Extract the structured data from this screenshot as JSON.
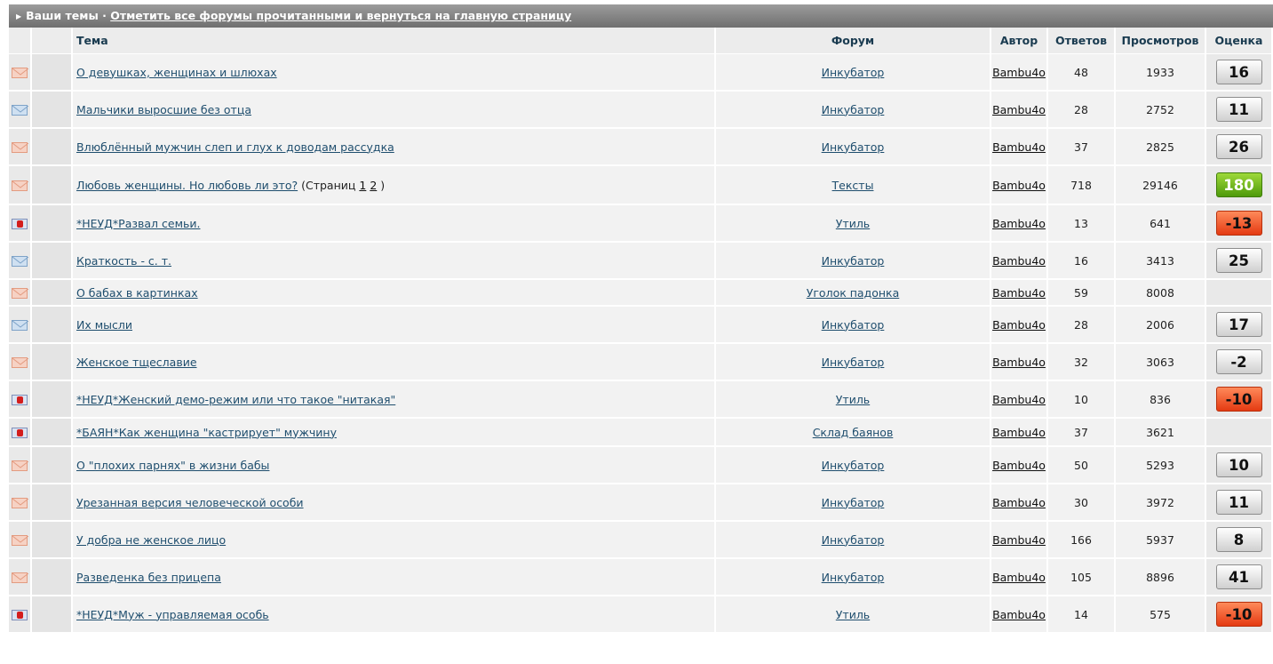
{
  "header": {
    "title": "Ваши темы",
    "separator": " · ",
    "mark_read_link": "Отметить все форумы прочитанными и вернуться на главную страницу"
  },
  "columns": {
    "topic": "Тема",
    "forum": "Форум",
    "author": "Автор",
    "replies": "Ответов",
    "views": "Просмотров",
    "rating": "Оценка"
  },
  "pages_prefix": "(Страниц",
  "pages_suffix": ")",
  "colors": {
    "rating_positive": "#5ea911",
    "rating_negative": "#f0541f",
    "rating_neutral": "#e6e6e6",
    "link": "#1f4e6e"
  },
  "rows": [
    {
      "icon": "envelope-orange-icon",
      "topic": "О девушках, женщинах и шлюхах",
      "forum": "Инкубатор",
      "author": "Bambu4o",
      "replies": "48",
      "views": "1933",
      "rating": "16",
      "rating_type": "neutral"
    },
    {
      "icon": "envelope-blue-icon",
      "topic": "Мальчики выросшие без отца",
      "forum": "Инкубатор",
      "author": "Bambu4o",
      "replies": "28",
      "views": "2752",
      "rating": "11",
      "rating_type": "neutral"
    },
    {
      "icon": "envelope-orange-icon",
      "topic": "Влюблённый мужчин слеп и глух к доводам рассудка",
      "forum": "Инкубатор",
      "author": "Bambu4o",
      "replies": "37",
      "views": "2825",
      "rating": "26",
      "rating_type": "neutral"
    },
    {
      "icon": "envelope-orange-icon",
      "topic": "Любовь женщины. Но любовь ли это?",
      "pages": [
        "1",
        "2"
      ],
      "forum": "Тексты",
      "author": "Bambu4o",
      "replies": "718",
      "views": "29146",
      "rating": "180",
      "rating_type": "positive"
    },
    {
      "icon": "envelope-locked-icon",
      "topic": "*НЕУД*Развал семьи.",
      "forum": "Утиль",
      "author": "Bambu4o",
      "replies": "13",
      "views": "641",
      "rating": "-13",
      "rating_type": "negative"
    },
    {
      "icon": "envelope-blue-icon",
      "topic": "Краткость - с. т.",
      "forum": "Инкубатор",
      "author": "Bambu4o",
      "replies": "16",
      "views": "3413",
      "rating": "25",
      "rating_type": "neutral"
    },
    {
      "icon": "envelope-orange-icon",
      "topic": "О бабах в картинках",
      "forum": "Уголок падонка",
      "author": "Bambu4o",
      "replies": "59",
      "views": "8008",
      "rating": "",
      "rating_type": "none"
    },
    {
      "icon": "envelope-blue-icon",
      "topic": "Их мысли",
      "forum": "Инкубатор",
      "author": "Bambu4o",
      "replies": "28",
      "views": "2006",
      "rating": "17",
      "rating_type": "neutral"
    },
    {
      "icon": "envelope-orange-icon",
      "topic": "Женское тщеславие",
      "forum": "Инкубатор",
      "author": "Bambu4o",
      "replies": "32",
      "views": "3063",
      "rating": "-2",
      "rating_type": "neutral"
    },
    {
      "icon": "envelope-locked-icon",
      "topic": "*НЕУД*Женский демо-режим или что такое \"нитакая\"",
      "forum": "Утиль",
      "author": "Bambu4o",
      "replies": "10",
      "views": "836",
      "rating": "-10",
      "rating_type": "negative"
    },
    {
      "icon": "envelope-locked-icon",
      "topic": "*БАЯН*Как женщина \"кастрирует\" мужчину",
      "forum": "Склад баянов",
      "author": "Bambu4o",
      "replies": "37",
      "views": "3621",
      "rating": "",
      "rating_type": "none"
    },
    {
      "icon": "envelope-orange-icon",
      "topic": "О \"плохих парнях\" в жизни бабы",
      "forum": "Инкубатор",
      "author": "Bambu4o",
      "replies": "50",
      "views": "5293",
      "rating": "10",
      "rating_type": "neutral"
    },
    {
      "icon": "envelope-orange-icon",
      "topic": "Урезанная версия человеческой особи",
      "forum": "Инкубатор",
      "author": "Bambu4o",
      "replies": "30",
      "views": "3972",
      "rating": "11",
      "rating_type": "neutral"
    },
    {
      "icon": "envelope-orange-icon",
      "topic": "У добра не женское лицо",
      "forum": "Инкубатор",
      "author": "Bambu4o",
      "replies": "166",
      "views": "5937",
      "rating": "8",
      "rating_type": "neutral"
    },
    {
      "icon": "envelope-orange-icon",
      "topic": "Разведенка без прицепа",
      "forum": "Инкубатор",
      "author": "Bambu4o",
      "replies": "105",
      "views": "8896",
      "rating": "41",
      "rating_type": "neutral"
    },
    {
      "icon": "envelope-locked-icon",
      "topic": "*НЕУД*Муж - управляемая особь",
      "forum": "Утиль",
      "author": "Bambu4o",
      "replies": "14",
      "views": "575",
      "rating": "-10",
      "rating_type": "negative"
    }
  ]
}
